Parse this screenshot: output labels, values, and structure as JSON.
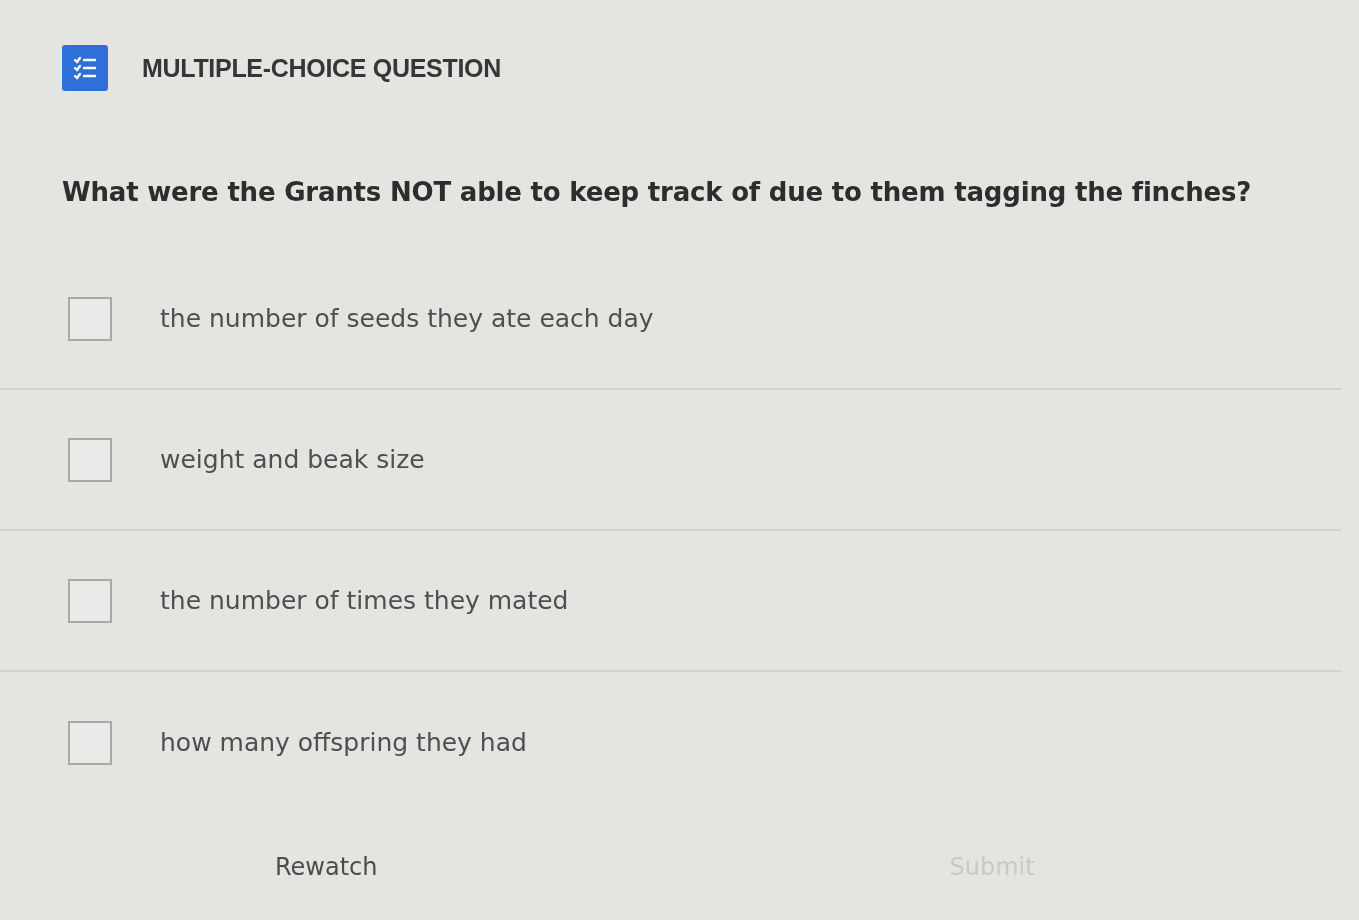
{
  "header": {
    "title": "MULTIPLE-CHOICE QUESTION"
  },
  "question": {
    "text": "What were the Grants NOT able to keep track of due to them tagging the finches?"
  },
  "options": [
    {
      "label": "the number of seeds they ate each day",
      "checked": false
    },
    {
      "label": "weight and beak size",
      "checked": false
    },
    {
      "label": "the number of times they mated",
      "checked": false
    },
    {
      "label": "how many offspring they had",
      "checked": false
    }
  ],
  "footer": {
    "buttons": [
      {
        "label": "Rewatch",
        "disabled": false
      },
      {
        "label": "Submit",
        "disabled": true
      }
    ]
  }
}
